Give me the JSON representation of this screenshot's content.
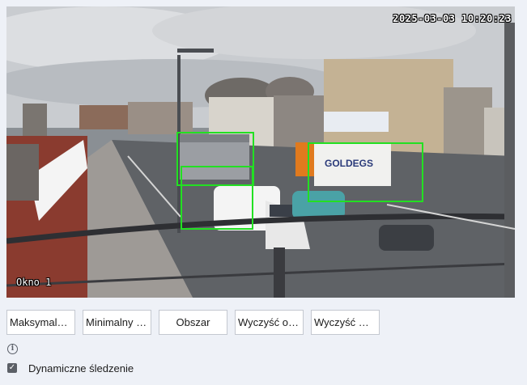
{
  "video": {
    "timestamp": "2025-03-03 10:20:23",
    "channel_name": "Okno 1",
    "truck_sign": "GOLDEGS"
  },
  "buttons": [
    {
      "label": "Maksymalny..."
    },
    {
      "label": "Minimalny o..."
    },
    {
      "label": "Obszar"
    },
    {
      "label": "Wyczyść ob..."
    },
    {
      "label": "Wyczyść ws..."
    }
  ],
  "options": {
    "dynamic_tracking": {
      "label": "Dynamiczne śledzenie",
      "checked": true
    }
  },
  "colors": {
    "detection_box": "#22e022",
    "background": "#eef1f7"
  },
  "icons": {
    "info": "info-icon",
    "checkbox": "checkbox-checked-icon"
  }
}
